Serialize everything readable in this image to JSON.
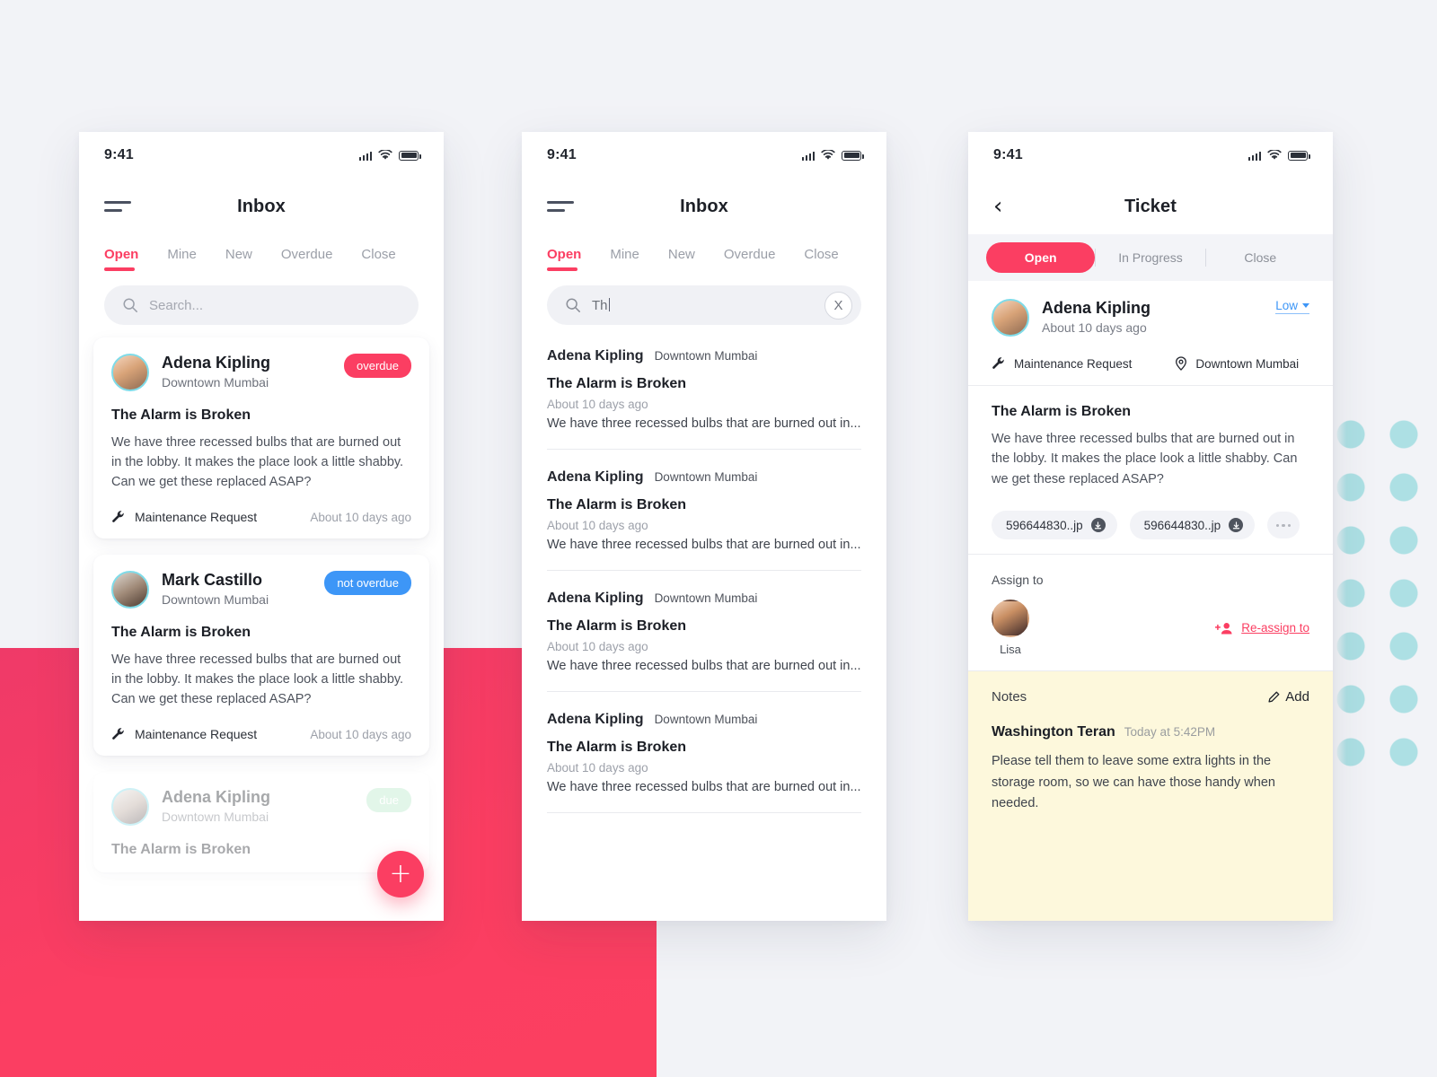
{
  "background": {
    "page_bg": "#F2F3F7",
    "accent_pink": "#FB3E62",
    "accent_blue": "#3D96F7",
    "accent_green": "#B5E8C8",
    "dots_color": "#ADE0E4",
    "notes_bg": "#FDF8DC"
  },
  "status_bar": {
    "time": "9:41"
  },
  "screen_inbox": {
    "title": "Inbox",
    "tabs": [
      {
        "label": "Open",
        "active": true
      },
      {
        "label": "Mine",
        "active": false
      },
      {
        "label": "New",
        "active": false
      },
      {
        "label": "Overdue",
        "active": false
      },
      {
        "label": "Close",
        "active": false
      }
    ],
    "search": {
      "placeholder": "Search...",
      "value": ""
    },
    "cards": [
      {
        "name": "Adena Kipling",
        "location": "Downtown Mumbai",
        "badge": "overdue",
        "badge_type": "overdue",
        "title": "The Alarm is Broken",
        "body": "We have three recessed bulbs that are burned out in the lobby. It makes the place look a little shabby. Can we get these replaced ASAP?",
        "category": "Maintenance Request",
        "time": "About 10 days ago"
      },
      {
        "name": "Mark Castillo",
        "location": "Downtown Mumbai",
        "badge": "not overdue",
        "badge_type": "notoverdue",
        "title": "The Alarm is Broken",
        "body": "We have three recessed bulbs that are burned out in the lobby. It makes the place look a little shabby. Can we get these replaced ASAP?",
        "category": "Maintenance Request",
        "time": "About 10 days ago"
      },
      {
        "name": "Adena Kipling",
        "location": "Downtown Mumbai",
        "badge": "due",
        "badge_type": "due",
        "title": "The Alarm is Broken",
        "body": "",
        "category": "",
        "time": ""
      }
    ],
    "fab_label": "+"
  },
  "screen_search": {
    "title": "Inbox",
    "tabs": [
      {
        "label": "Open",
        "active": true
      },
      {
        "label": "Mine",
        "active": false
      },
      {
        "label": "New",
        "active": false
      },
      {
        "label": "Overdue",
        "active": false
      },
      {
        "label": "Close",
        "active": false
      }
    ],
    "search": {
      "value": "Th",
      "clear_label": "X"
    },
    "results": [
      {
        "name": "Adena Kipling",
        "location": "Downtown Mumbai",
        "title": "The Alarm is Broken",
        "time": "About 10 days ago",
        "snippet": "We have three recessed bulbs that are burned out in..."
      },
      {
        "name": "Adena Kipling",
        "location": "Downtown Mumbai",
        "title": "The Alarm is Broken",
        "time": "About 10 days ago",
        "snippet": "We have three recessed bulbs that are burned out in..."
      },
      {
        "name": "Adena Kipling",
        "location": "Downtown Mumbai",
        "title": "The Alarm is Broken",
        "time": "About 10 days ago",
        "snippet": "We have three recessed bulbs that are burned out in..."
      },
      {
        "name": "Adena Kipling",
        "location": "Downtown Mumbai",
        "title": "The Alarm is Broken",
        "time": "About 10 days ago",
        "snippet": "We have three recessed bulbs that are burned out in..."
      }
    ]
  },
  "screen_ticket": {
    "title": "Ticket",
    "segments": [
      {
        "label": "Open",
        "active": true
      },
      {
        "label": "In Progress",
        "active": false
      },
      {
        "label": "Close",
        "active": false
      }
    ],
    "requester": {
      "name": "Adena Kipling",
      "time": "About 10 days ago",
      "priority": "Low"
    },
    "meta": {
      "category": "Maintenance Request",
      "location": "Downtown Mumbai"
    },
    "ticket": {
      "title": "The Alarm is Broken",
      "body": "We have three recessed bulbs that are burned out in the lobby. It makes the place look a little shabby. Can we get these replaced ASAP?"
    },
    "attachments": [
      {
        "name": "596644830..jp"
      },
      {
        "name": "596644830..jp"
      }
    ],
    "assign": {
      "label": "Assign to",
      "person": "Lisa",
      "reassign_label": "Re-assign to"
    },
    "notes": {
      "label": "Notes",
      "add_label": "Add",
      "author": "Washington Teran",
      "time": "Today at 5:42PM",
      "text": "Please tell them to leave some extra lights in the storage room, so we can have those handy when needed."
    }
  }
}
